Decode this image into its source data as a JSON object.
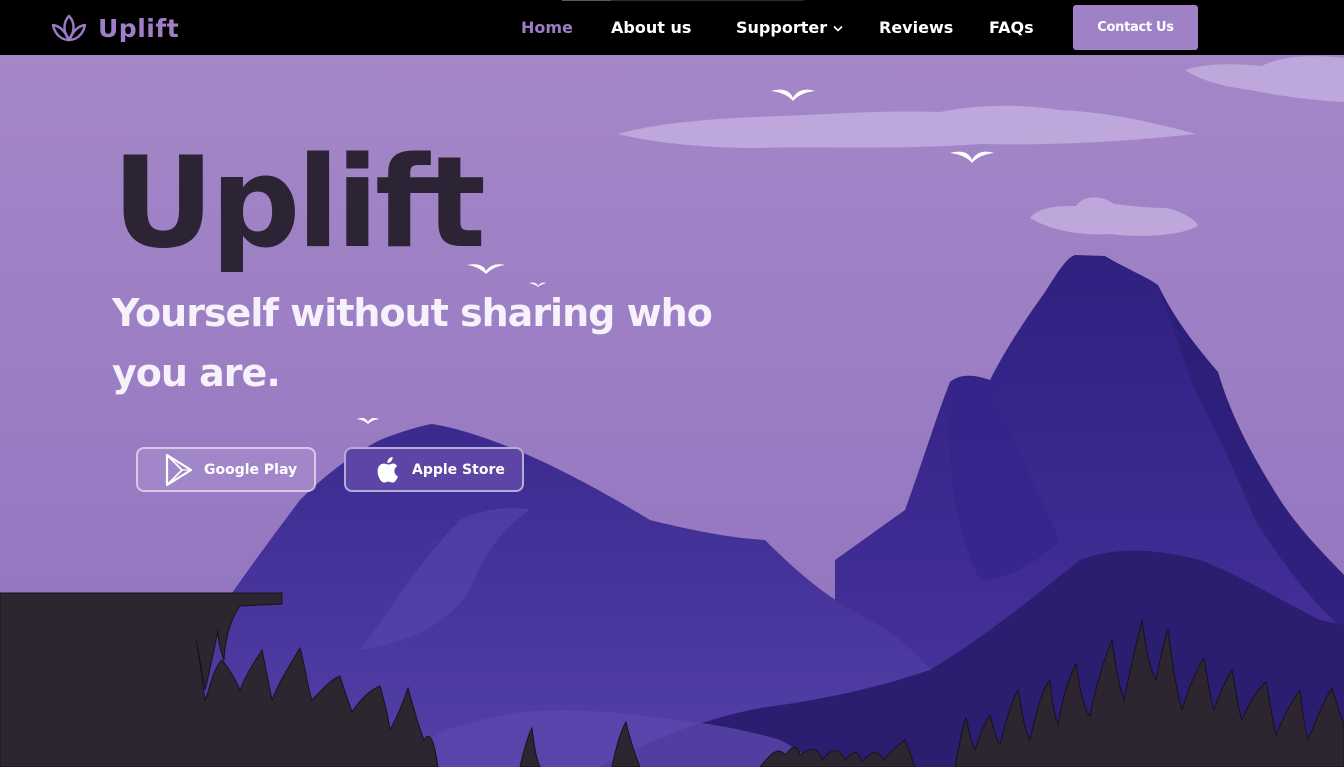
{
  "brand": {
    "name": "Uplift",
    "icon": "lotus-icon"
  },
  "nav": {
    "items": [
      {
        "label": "Home",
        "active": true
      },
      {
        "label": "About us"
      },
      {
        "label": "Supporter",
        "has_dropdown": true
      },
      {
        "label": "Reviews"
      },
      {
        "label": "FAQs"
      }
    ],
    "contact_label": "Contact Us"
  },
  "hero": {
    "title": "Uplift",
    "subtitle": "Yourself without sharing who you are."
  },
  "store_buttons": {
    "google": {
      "label": "Google Play",
      "icon": "google-play-icon"
    },
    "apple": {
      "label": "Apple Store",
      "icon": "apple-icon"
    }
  },
  "colors": {
    "nav_bg": "#000000",
    "accent": "#9f82c6",
    "sky": "#9d82c4",
    "title": "#2c2434",
    "mountain_far": "#3b2690",
    "mountain_near": "#2a1d6e",
    "foreground": "#2d2530"
  }
}
